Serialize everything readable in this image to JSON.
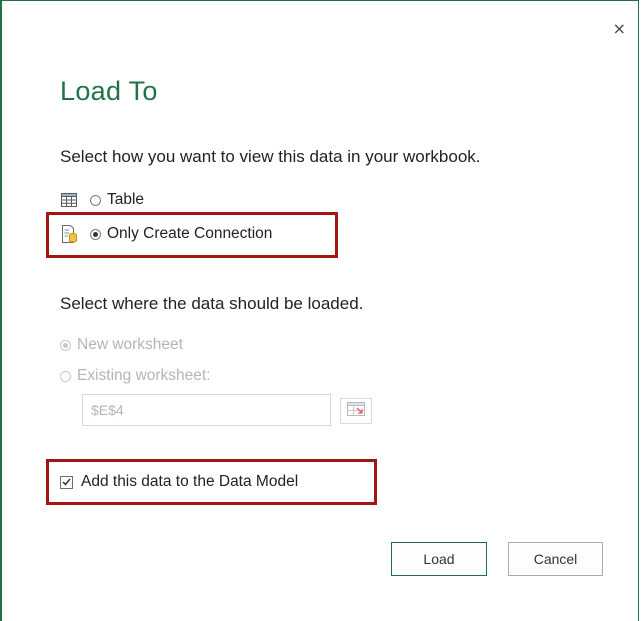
{
  "dialog": {
    "close_symbol": "×",
    "title": "Load To",
    "view_prompt": "Select how you want to view this data in your workbook.",
    "view_options": [
      {
        "label": "Table",
        "icon": "table-icon",
        "selected": false
      },
      {
        "label": "Only Create Connection",
        "icon": "connection-icon",
        "selected": true
      }
    ],
    "location_prompt": "Select where the data should be loaded.",
    "location_options": [
      {
        "label": "New worksheet",
        "selected": true,
        "disabled": true
      },
      {
        "label": "Existing worksheet:",
        "selected": false,
        "disabled": true
      }
    ],
    "cell_reference": "$E$4",
    "data_model_label": "Add this data to the Data Model",
    "data_model_checked": true,
    "load_label": "Load",
    "cancel_label": "Cancel"
  },
  "colors": {
    "accent": "#217346",
    "highlight": "#a31515",
    "disabled_text": "#b5b5b5"
  }
}
